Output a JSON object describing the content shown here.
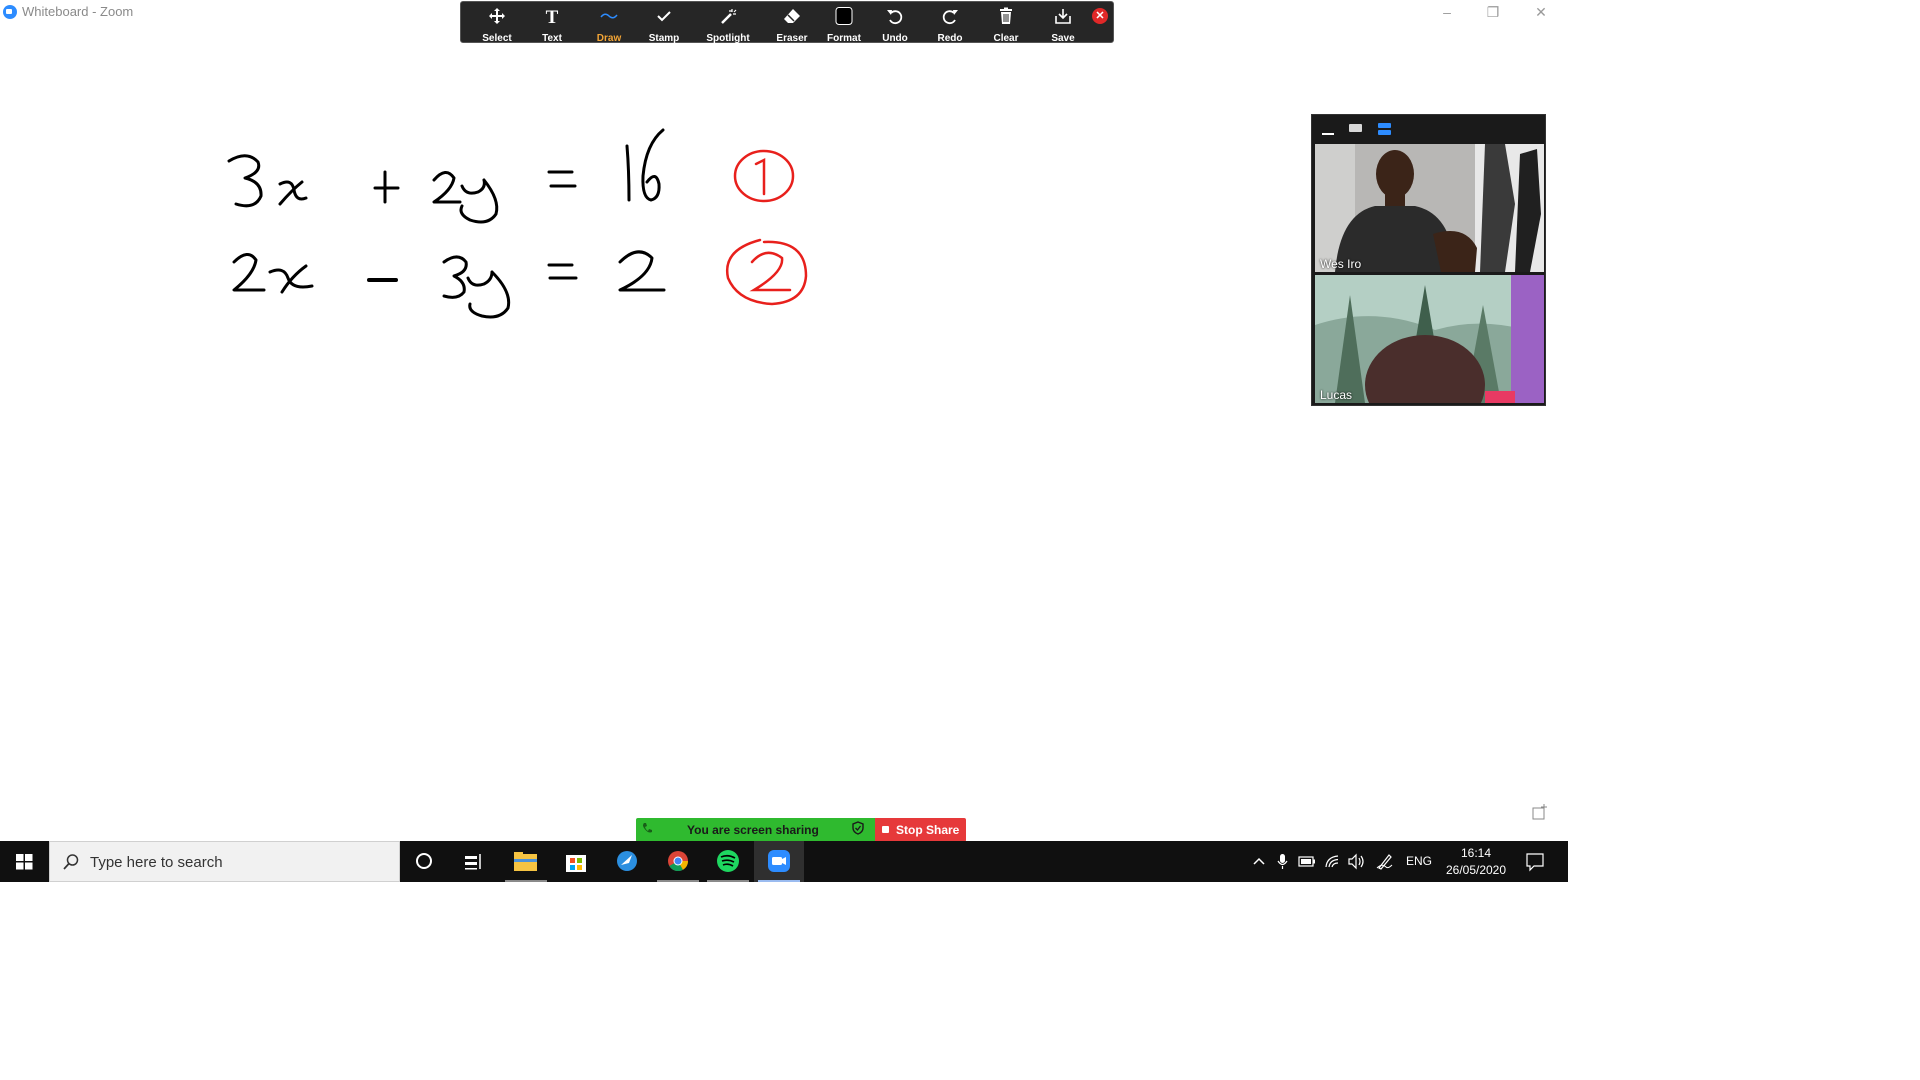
{
  "window": {
    "title": "Whiteboard - Zoom",
    "controls": [
      "–",
      "❐",
      "✕"
    ]
  },
  "toolbar": {
    "tools": [
      {
        "label": "Select",
        "icon": "move-icon"
      },
      {
        "label": "Text",
        "icon": "text-icon"
      },
      {
        "label": "Draw",
        "icon": "draw-squiggle-icon",
        "active": true
      },
      {
        "label": "Stamp",
        "icon": "checkmark-icon"
      },
      {
        "label": "Spotlight",
        "icon": "magic-wand-icon"
      },
      {
        "label": "Eraser",
        "icon": "eraser-icon"
      },
      {
        "label": "Format",
        "icon": "format-square-icon"
      },
      {
        "label": "Undo",
        "icon": "undo-icon"
      },
      {
        "label": "Redo",
        "icon": "redo-icon"
      },
      {
        "label": "Clear",
        "icon": "trash-icon"
      },
      {
        "label": "Save",
        "icon": "download-icon"
      }
    ],
    "close_icon": "close-icon",
    "active_color": "#f3a536"
  },
  "whiteboard": {
    "equations": [
      {
        "text": "3x + 2y = 16",
        "marker": "1"
      },
      {
        "text": "2x - 3y = 2",
        "marker": "2"
      }
    ],
    "ink_color": "#000000",
    "marker_color": "#e8201c"
  },
  "gallery": {
    "participants": [
      {
        "name": "Wes Iro"
      },
      {
        "name": "Lucas"
      }
    ]
  },
  "share_bar": {
    "status": "You are screen sharing",
    "stop": "Stop Share",
    "green": "#2fba2f",
    "red": "#e6393a"
  },
  "taskbar": {
    "search_placeholder": "Type here to search",
    "apps": [
      "cortana-icon",
      "task-view-icon",
      "file-explorer-icon",
      "store-icon",
      "edge-icon",
      "chrome-icon",
      "spotify-icon",
      "zoom-icon"
    ],
    "language": "ENG",
    "time": "16:14",
    "date": "26/05/2020"
  }
}
